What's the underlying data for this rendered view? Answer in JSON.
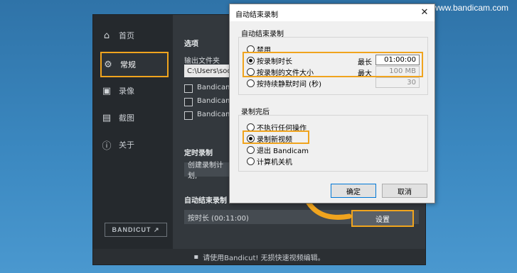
{
  "watermark": "www.bandicam.com",
  "app": {
    "sidebar": [
      {
        "label": "首页",
        "icon": "home-icon"
      },
      {
        "label": "常规",
        "icon": "gear-icon"
      },
      {
        "label": "录像",
        "icon": "video-icon"
      },
      {
        "label": "截图",
        "icon": "image-icon"
      },
      {
        "label": "关于",
        "icon": "info-icon"
      }
    ],
    "logo": "BANDICUT ↗",
    "main": {
      "section": "选项",
      "output_label": "输出文件夹",
      "output_path": "C:\\Users\\soo",
      "checkboxes": [
        "Bandicam",
        "Bandicam",
        "Bandicam"
      ],
      "schedule_label": "定时录制",
      "schedule_value": "创建录制计划,",
      "autostop_label": "自动结束录制",
      "autostop_value": "按时长 (00:11:00)",
      "settings_button": "设置"
    },
    "footer": "请使用Bandicut! 无损快速视频编辑。"
  },
  "dialog": {
    "title": "自动结束录制",
    "close": "✕",
    "group1_title": "自动结束录制",
    "options1": [
      {
        "label": "禁用",
        "selected": false
      },
      {
        "label": "按录制时长",
        "selected": true
      },
      {
        "label": "按录制的文件大小",
        "selected": false
      },
      {
        "label": "按持续静默时间 (秒)",
        "selected": false
      }
    ],
    "max_duration_label": "最长",
    "max_duration_value": "01:00:00",
    "max_size_label": "最大",
    "max_size_value": "100 MB",
    "silence_value": "30",
    "group2_title": "录制完后",
    "options2": [
      {
        "label": "不执行任何操作",
        "selected": false
      },
      {
        "label": "录制新视频",
        "selected": true
      },
      {
        "label": "退出 Bandicam",
        "selected": false
      },
      {
        "label": "计算机关机",
        "selected": false
      }
    ],
    "ok": "确定",
    "cancel": "取消"
  },
  "colors": {
    "highlight": "#f0a41e",
    "background": "#3b88c0"
  }
}
